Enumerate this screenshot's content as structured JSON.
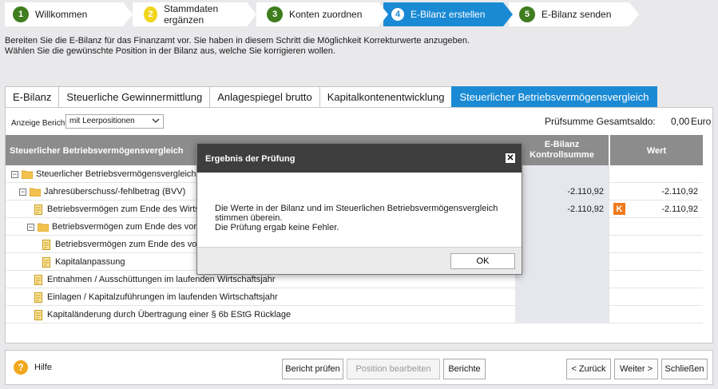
{
  "wizard": {
    "steps": [
      {
        "num": "1",
        "label": "Willkommen",
        "color": "#3f7d1e"
      },
      {
        "num": "2",
        "label": "Stammdaten ergänzen",
        "color": "#f2d51d"
      },
      {
        "num": "3",
        "label": "Konten zuordnen",
        "color": "#3f7d1e"
      },
      {
        "num": "4",
        "label": "E-Bilanz erstellen",
        "color": "#ffffff"
      },
      {
        "num": "5",
        "label": "E-Bilanz senden",
        "color": "#3f7d1e"
      }
    ]
  },
  "intro": {
    "line1": "Bereiten Sie die E-Bilanz für das Finanzamt vor. Sie haben in diesem Schritt die Möglichkeit Korrekturwerte anzugeben.",
    "line2": "Wählen Sie die gewünschte Position in der Bilanz aus, welche Sie korrigieren wollen."
  },
  "tabs": [
    "E-Bilanz",
    "Steuerliche Gewinnermittlung",
    "Anlagespiegel brutto",
    "Kapitalkontenentwicklung",
    "Steuerlicher Betriebsvermögensvergleich"
  ],
  "toolbar": {
    "anzeige_label": "Anzeige Bericht:",
    "anzeige_value": "mit Leerpositionen",
    "sum_label": "Prüfsumme Gesamtsaldo:",
    "sum_value": "0,00",
    "sum_currency": "Euro"
  },
  "table": {
    "col_name": "Steuerlicher Betriebsvermögensvergleich",
    "col_kontroll_1": "E-Bilanz",
    "col_kontroll_2": "Kontrollsumme",
    "col_wert": "Wert",
    "rows": [
      {
        "label": "Steuerlicher Betriebsvermögensvergleich",
        "kontroll": "",
        "wert": ""
      },
      {
        "label": "Jahresüberschuss/-fehlbetrag (BVV)",
        "kontroll": "-2.110,92",
        "wert": "-2.110,92"
      },
      {
        "label": "Betriebsvermögen zum Ende des Wirtschaftsjahr",
        "kontroll": "-2.110,92",
        "wert": "-2.110,92",
        "badge": "K"
      },
      {
        "label": "Betriebsvermögen zum Ende des vorangegang",
        "kontroll": "",
        "wert": ""
      },
      {
        "label": "Betriebsvermögen zum Ende des vorangegan",
        "kontroll": "",
        "wert": ""
      },
      {
        "label": "Kapitalanpassung",
        "kontroll": "",
        "wert": ""
      },
      {
        "label": "Entnahmen / Ausschüttungen im laufenden Wirtschaftsjahr",
        "kontroll": "",
        "wert": ""
      },
      {
        "label": "Einlagen / Kapitalzuführungen im laufenden Wirtschaftsjahr",
        "kontroll": "",
        "wert": ""
      },
      {
        "label": "Kapitaländerung durch Übertragung einer § 6b EStG Rücklage",
        "kontroll": "",
        "wert": ""
      }
    ]
  },
  "modal": {
    "title": "Ergebnis der Prüfung",
    "close": "✕",
    "line1": "Die Werte in der Bilanz und im Steuerlichen Betriebsvermögensvergleich stimmen überein.",
    "line2": "Die Prüfung ergab keine Fehler.",
    "ok": "OK"
  },
  "footer": {
    "help": "Hilfe",
    "bericht_pruefen": "Bericht prüfen",
    "position_bearbeiten": "Position bearbeiten",
    "berichte": "Berichte",
    "zurueck": "< Zurück",
    "weiter": "Weiter >",
    "schliessen": "Schließen"
  },
  "colors": {
    "accent": "#1a8ad4",
    "k_badge": "#f07a1e",
    "help": "#f2a81d"
  }
}
